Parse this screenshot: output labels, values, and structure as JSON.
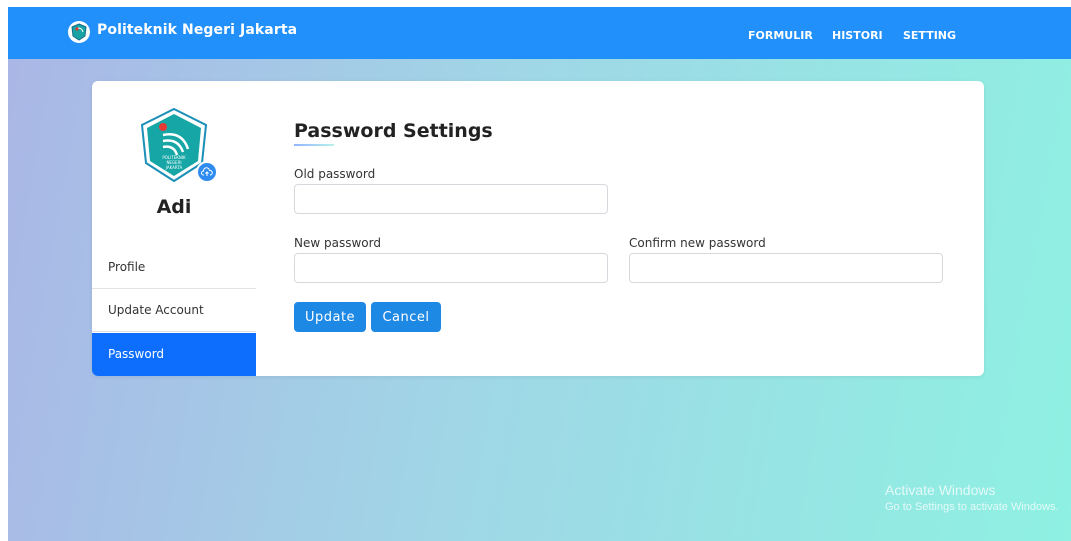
{
  "header": {
    "brand": "Politeknik Negeri Jakarta",
    "nav": [
      "FORMULIR",
      "HISTORI",
      "SETTING"
    ]
  },
  "profile": {
    "name": "Adi",
    "logo_text": [
      "POLITEKNIK",
      "NEGERI",
      "JAKARTA"
    ]
  },
  "sidebar": {
    "items": [
      {
        "label": "Profile"
      },
      {
        "label": "Update Account"
      },
      {
        "label": "Password",
        "active": true
      }
    ]
  },
  "form": {
    "title": "Password Settings",
    "old_password_label": "Old password",
    "old_password_value": "",
    "new_password_label": "New password",
    "new_password_value": "",
    "confirm_password_label": "Confirm new password",
    "confirm_password_value": "",
    "update_label": "Update",
    "cancel_label": "Cancel"
  },
  "watermark": {
    "title": "Activate Windows",
    "subtitle": "Go to Settings to activate Windows."
  },
  "colors": {
    "navbar": "#2290fb",
    "active_sidebar": "#0d6efd",
    "button": "#1e88e5"
  }
}
